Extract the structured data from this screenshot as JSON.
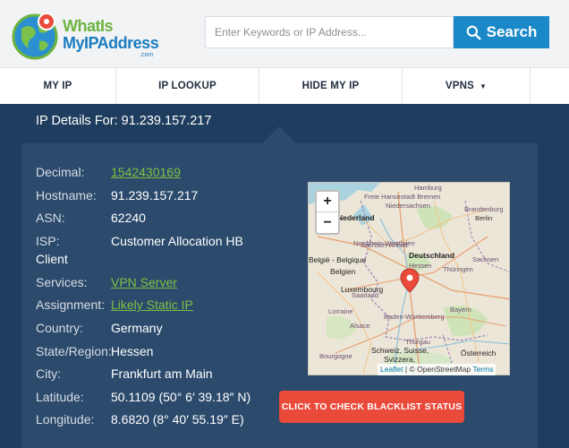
{
  "logo": {
    "line1": "WhatIs",
    "line2": "MyIPAddress",
    "line3": ".com"
  },
  "search": {
    "placeholder": "Enter Keywords or IP Address...",
    "button_label": "Search"
  },
  "nav": [
    {
      "label": "MY IP"
    },
    {
      "label": "IP LOOKUP"
    },
    {
      "label": "HIDE MY IP"
    },
    {
      "label": "VPNS"
    }
  ],
  "nav_caret": "▼",
  "ip_heading": "IP Details For: 91.239.157.217",
  "details": {
    "decimal": {
      "label": "Decimal:",
      "value": "1542430169"
    },
    "hostname": {
      "label": "Hostname:",
      "value": "91.239.157.217"
    },
    "asn": {
      "label": "ASN:",
      "value": "62240"
    },
    "isp": {
      "label": "ISP:",
      "value": "Customer Allocation HB",
      "continuation": "Client"
    },
    "services": {
      "label": "Services:",
      "value": "VPN Server"
    },
    "assignment": {
      "label": "Assignment:",
      "value": "Likely Static IP"
    },
    "country": {
      "label": "Country:",
      "value": "Germany"
    },
    "state": {
      "label": "State/Region:",
      "value": "Hessen"
    },
    "city": {
      "label": "City:",
      "value": "Frankfurt am Main"
    },
    "latitude": {
      "label": "Latitude:",
      "value": "50.1109 (50° 6′ 39.18″ N)"
    },
    "longitude": {
      "label": "Longitude:",
      "value": "8.6820 (8° 40′ 55.19″ E)"
    }
  },
  "map": {
    "zoom_in": "+",
    "zoom_out": "−",
    "attribution_leaflet": "Leaflet",
    "attribution_sep": " | © OpenStreetMap ",
    "attribution_terms": "Terms",
    "labels": {
      "hamburg": "Hamburg",
      "freie_hansestadt_bremen": "Freie Hansestadt Bremen",
      "niedersachsen": "Niedersachsen",
      "brandenburg": "Brandenburg",
      "berlin": "Berlin",
      "nederland": "Nederland",
      "nordrhein_westfalen": "Nordrhein-Westfalen",
      "deutschland": "Deutschland",
      "sachsen_anhalt": "Sachsen-Anhalt",
      "sachsen": "Sachsen",
      "belgie": "België - Belgique",
      "belgien": "Belgien",
      "hessen": "Hessen",
      "thuringen": "Thüringen",
      "luxembourg": "Luxembourg",
      "saarland": "Saarland",
      "bayern": "Bayern",
      "lorraine": "Lorraine",
      "baden_wurttemberg": "Baden-Württemberg",
      "alsace": "Alsace",
      "schweiz": "Schweiz, Suisse,",
      "svizzera": "Svizzera,",
      "osterreich": "Österreich",
      "bourgogne": "Bourgogne",
      "thurgau": "Thurgau"
    }
  },
  "blacklist_button": "CLICK TO CHECK BLACKLIST STATUS",
  "colors": {
    "accent_blue": "#1b89c8",
    "link_green": "#7fc142",
    "panel_navy": "#2b4a6c",
    "button_red": "#e94a3a"
  }
}
